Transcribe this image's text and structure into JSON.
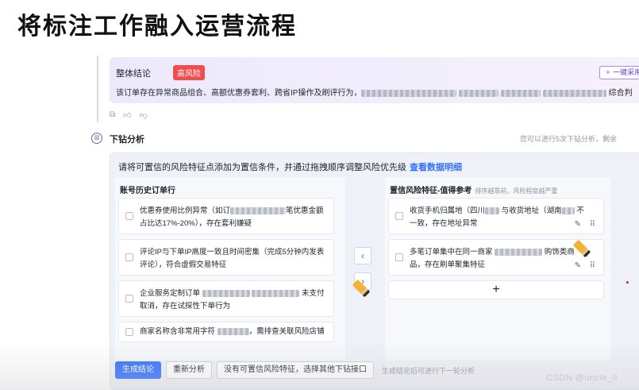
{
  "slide_title": "将标注工作融入运营流程",
  "conclusion": {
    "title": "整体结论",
    "risk_badge": "高风险",
    "text_prefix": "该订单存在异常商品组合、高额优惠券套利、跨省IP操作及刷评行为，",
    "text_suffix": "综合判定为高风险",
    "adopt_button": "一键采用"
  },
  "feedback_icons": [
    "copy-icon",
    "thumbs-up-icon",
    "thumbs-down-icon"
  ],
  "drill": {
    "title": "下钻分析",
    "hint": "您可以进行5次下钻分析，剩余",
    "instruction": "请将可置信的风险特征点添加为置信条件，并通过拖拽顺序调整风险优先级",
    "instruction_link": "查看数据明细"
  },
  "left_panel": {
    "title": "账号历史订单行",
    "items": [
      {
        "part1": "优惠券使用比例异常（如订",
        "part2": "笔优惠金额占比达17%-20%），存在套利嫌疑"
      },
      {
        "part1": "评论IP与下单IP高度一致且时间密集（完成5分钟内发表评论），符合虚假交易特征",
        "part2": ""
      },
      {
        "part1": "企业服务定制订单",
        "part2": "未支付取消，存在试探性下单行为"
      },
      {
        "part1": "商家名称含非常用字符",
        "part2": "，需排查关联风险店铺"
      }
    ]
  },
  "right_panel": {
    "title": "置信风险特征-值得参考",
    "subtitle": "排序越靠前，风险程度越严重",
    "items": [
      {
        "part1": "收货手机归属地（四川",
        "part2": "与收货地址（湖南",
        "part3": "不一致，存在地址异常"
      },
      {
        "part1": "多笔订单集中在同一商家",
        "part2": "购",
        "part3": "饰类商品，存在刷单聚集特征"
      }
    ],
    "add_label": "+"
  },
  "arrows": {
    "left": "‹",
    "right": "›"
  },
  "actions": {
    "generate": "生成结论",
    "reanalyze": "重新分析",
    "no_feature": "没有可置信风险特征，选择其他下钻接口",
    "hint": "生成结论后可进行下一轮分析"
  },
  "watermark": "CSDN @uncle_ll"
}
